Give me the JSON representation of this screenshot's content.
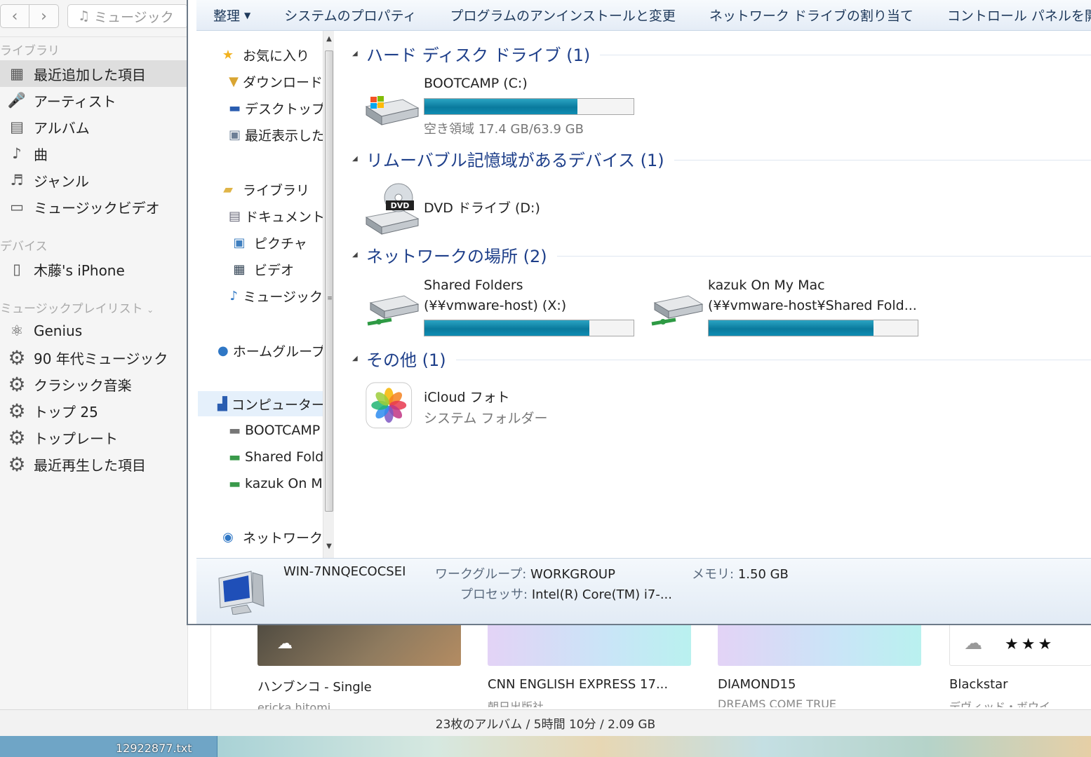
{
  "itunes": {
    "search_placeholder": "ミュージック",
    "sections": {
      "library": "ライブラリ",
      "devices": "デバイス",
      "playlists": "ミュージックプレイリスト"
    },
    "library_items": [
      "最近追加した項目",
      "アーティスト",
      "アルバム",
      "曲",
      "ジャンル",
      "ミュージックビデオ"
    ],
    "device": "木藤's iPhone",
    "playlists": [
      "Genius",
      "90 年代ミュージック",
      "クラシック音楽",
      "トップ 25",
      "トップレート",
      "最近再生した項目"
    ],
    "albums": [
      {
        "title": "ハンブンコ - Single",
        "artist": "ericka hitomi"
      },
      {
        "title": "CNN ENGLISH EXPRESS 17...",
        "artist": "朝日出版社"
      },
      {
        "title": "DIAMOND15",
        "artist": "DREAMS COME TRUE"
      },
      {
        "title": "Blackstar",
        "artist": "デヴィッド・ボウイ"
      }
    ],
    "status": "23枚のアルバム / 5時間 10分 / 2.09 GB"
  },
  "desktop": {
    "file": "12922877.txt"
  },
  "explorer": {
    "toolbar": [
      "整理",
      "システムのプロパティ",
      "プログラムのアンインストールと変更",
      "ネットワーク ドライブの割り当て",
      "コントロール パネルを開く"
    ],
    "nav": {
      "favorites": "お気に入り",
      "fav_items": [
        "ダウンロード",
        "デスクトップ",
        "最近表示した場所"
      ],
      "libraries": "ライブラリ",
      "lib_items": [
        "ドキュメント",
        "ピクチャ",
        "ビデオ",
        "ミュージック"
      ],
      "homegroup": "ホームグループ",
      "computer": "コンピューター",
      "computer_items": [
        "BOOTCAMP (C:)",
        "Shared Folders (\\\\vmware-host) (X:)",
        "kazuk On My Mac"
      ],
      "network": "ネットワーク"
    },
    "groups": {
      "hdd": "ハード ディスク ドライブ (1)",
      "removable": "リムーバブル記憶域があるデバイス (1)",
      "network": "ネットワークの場所 (2)",
      "other": "その他 (1)"
    },
    "drives": {
      "c": {
        "name": "BOOTCAMP (C:)",
        "free": "空き領域 17.4 GB/63.9 GB",
        "used_fraction": 0.73
      },
      "d": {
        "name": "DVD ドライブ (D:)"
      },
      "x": {
        "name": "Shared Folders",
        "sub": "(¥¥vmware-host) (X:)",
        "used_fraction": 0.79
      },
      "mac": {
        "name": "kazuk On My Mac",
        "sub": "(¥¥vmware-host¥Shared Fold...",
        "used_fraction": 0.79
      }
    },
    "icloud": {
      "name": "iCloud フォト",
      "type": "システム フォルダー"
    },
    "details": {
      "computer_name": "WIN-7NNQECOCSEI",
      "workgroup_label": "ワークグループ:",
      "workgroup": "WORKGROUP",
      "memory_label": "メモリ:",
      "memory": "1.50 GB",
      "processor_label": "プロセッサ:",
      "processor": "Intel(R) Core(TM) i7-..."
    }
  }
}
